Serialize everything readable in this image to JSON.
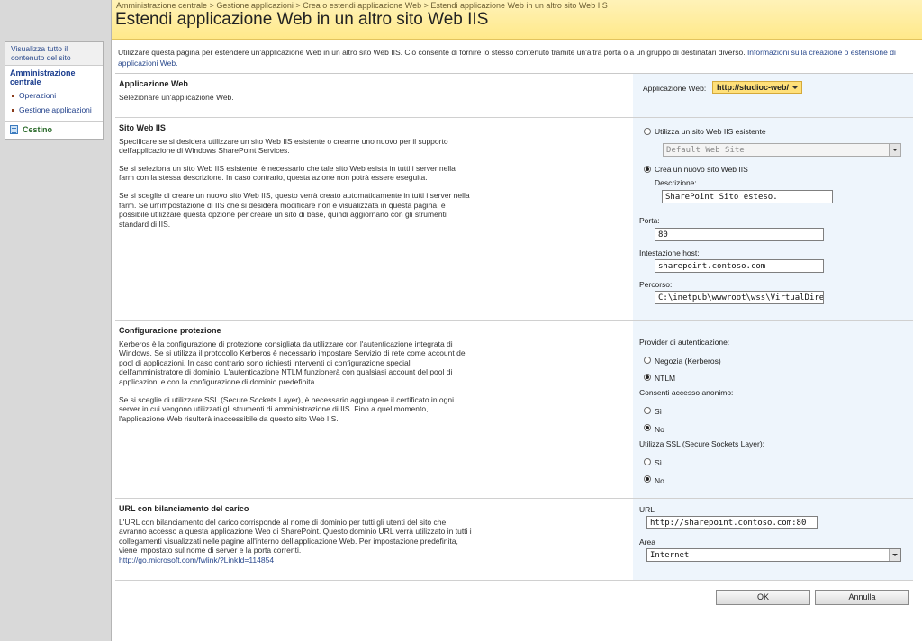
{
  "breadcrumb": {
    "items": [
      "Amministrazione centrale",
      "Gestione applicazioni",
      "Crea o estendi applicazione Web",
      "Estendi applicazione Web in un altro sito Web IIS"
    ],
    "separator": ">"
  },
  "page_title": "Estendi applicazione Web in un altro sito Web IIS",
  "leftnav": {
    "view_all": "Visualizza tutto il contenuto del sito",
    "section": "Amministrazione centrale",
    "items": [
      "Operazioni",
      "Gestione applicazioni"
    ],
    "recycle": "Cestino"
  },
  "intro": {
    "text": "Utilizzare questa pagina per estendere un'applicazione Web in un altro sito Web IIS. Ciò consente di fornire lo stesso contenuto tramite un'altra porta o a un gruppo di destinatari diverso.",
    "link": "Informazioni sulla creazione o estensione di applicazioni Web."
  },
  "sections": {
    "webapp": {
      "title": "Applicazione Web",
      "desc": "Selezionare un'applicazione Web.",
      "label": "Applicazione Web:",
      "value": "http://studioc-web/"
    },
    "iis": {
      "title": "Sito Web IIS",
      "p1": "Specificare se si desidera utilizzare un sito Web IIS esistente o crearne uno nuovo per il supporto dell'applicazione di Windows SharePoint Services.",
      "p2": "Se si seleziona un sito Web IIS esistente, è necessario che tale sito Web esista in tutti i server nella farm con la stessa descrizione. In caso contrario, questa azione non potrà essere eseguita.",
      "p3": "Se si sceglie di creare un nuovo sito Web IIS, questo verrà creato automaticamente in tutti i server nella farm. Se un'impostazione di IIS che si desidera modificare non è visualizzata in questa pagina, è possibile utilizzare questa opzione per creare un sito di base, quindi aggiornarlo con gli strumenti standard di IIS.",
      "use_existing_label": "Utilizza un sito Web IIS esistente",
      "existing_site": "Default Web Site",
      "create_new_label": "Crea un nuovo sito Web IIS",
      "description_label": "Descrizione:",
      "description_value": "SharePoint Sito esteso.",
      "port_label": "Porta:",
      "port_value": "80",
      "host_label": "Intestazione host:",
      "host_value": "sharepoint.contoso.com",
      "path_label": "Percorso:",
      "path_value": "C:\\inetpub\\wwwroot\\wss\\VirtualDirector"
    },
    "security": {
      "title": "Configurazione protezione",
      "p1": "Kerberos è la configurazione di protezione consigliata da utilizzare con l'autenticazione integrata di Windows. Se si utilizza il protocollo Kerberos è necessario impostare Servizio di rete come account del pool di applicazioni. In caso contrario sono richiesti interventi di configurazione speciali dell'amministratore di dominio. L'autenticazione NTLM funzionerà con qualsiasi account del pool di applicazioni e con la configurazione di dominio predefinita.",
      "p2": "Se si sceglie di utilizzare SSL (Secure Sockets Layer), è necessario aggiungere il certificato in ogni server in cui vengono utilizzati gli strumenti di amministrazione di IIS. Fino a quel momento, l'applicazione Web risulterà inaccessibile da questo sito Web IIS.",
      "auth_label": "Provider di autenticazione:",
      "kerberos": "Negozia (Kerberos)",
      "ntlm": "NTLM",
      "anon_label": "Consenti accesso anonimo:",
      "yes": "Sì",
      "no": "No",
      "ssl_label": "Utilizza SSL (Secure Sockets Layer):"
    },
    "lb": {
      "title": "URL con bilanciamento del carico",
      "p1": "L'URL con bilanciamento del carico corrisponde al nome di dominio per tutti gli utenti del sito che avranno accesso a questa applicazione Web di SharePoint. Questo dominio URL verrà utilizzato in tutti i collegamenti visualizzati nelle pagine all'interno dell'applicazione Web. Per impostazione predefinita, viene impostato sul nome di server e la porta correnti.",
      "link": "http://go.microsoft.com/fwlink/?LinkId=114854",
      "url_label": "URL",
      "url_value": "http://sharepoint.contoso.com:80",
      "zone_label": "Area",
      "zone_value": "Internet"
    }
  },
  "buttons": {
    "ok": "OK",
    "cancel": "Annulla"
  },
  "colors": {
    "header": "#ffe98a",
    "panel": "#eef5fc",
    "link": "#2b4a8d"
  }
}
